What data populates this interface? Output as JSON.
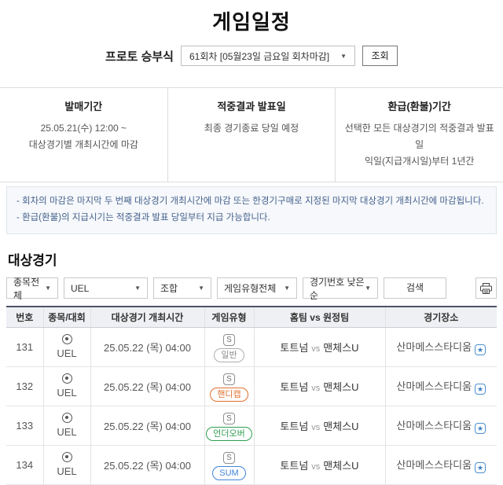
{
  "page": {
    "title": "게임일정"
  },
  "proto": {
    "label": "프로토 승부식",
    "round_selected": "61회차 [05월23일 금요일 회차마감]",
    "inquiry_button": "조회"
  },
  "info_columns": {
    "sale": {
      "title": "발매기간",
      "line1": "25.05.21(수) 12:00 ~",
      "line2": "대상경기별 개최시간에 마감"
    },
    "result": {
      "title": "적중결과 발표일",
      "line1": "최종 경기종료 당일 예정"
    },
    "refund": {
      "title": "환급(환불)기간",
      "line1": "선택한 모든 대상경기의 적중결과 발표일",
      "line2": "익일(지급개시일)부터 1년간"
    }
  },
  "notes": {
    "line1": "- 회차의 마감은 마지막 두 번째 대상경기 개최시간에 마감 또는 한경기구매로 지정된 마지막 대상경기 개최시간에 마감됩니다.",
    "line2": "- 환급(환불)의 지급시기는 적중결과 발표 당일부터 지급 가능합니다."
  },
  "target_section": {
    "title": "대상경기",
    "filters": {
      "sport": "종목전체",
      "league": "UEL",
      "combo": "조합",
      "game_type": "게임유형전체",
      "sort": "경기번호 낮은순"
    },
    "search_button": "검색",
    "print_icon": "printer-icon"
  },
  "colors": {
    "type_normal": "#aeaeae",
    "type_handicap": "#e0702f",
    "type_underover": "#2f9e50",
    "type_sum": "#4184d9",
    "venue_link": "#3a72b5",
    "header_top_border": "#4c5465",
    "note_text": "#44618c"
  },
  "table": {
    "headers": {
      "no": "번호",
      "league": "종목/대회",
      "time": "대상경기 개최시간",
      "type": "게임유형",
      "teams": "홈팀 vs 원정팀",
      "venue": "경기장소"
    },
    "s_badge": "S",
    "vs": "vs",
    "star": "★",
    "rows": [
      {
        "no": "131",
        "league": "UEL",
        "time": "25.05.22 (목) 04:00",
        "type_label": "일반",
        "home": "토트넘",
        "away": "맨체스U",
        "venue": "산마메스스타디움"
      },
      {
        "no": "132",
        "league": "UEL",
        "time": "25.05.22 (목) 04:00",
        "type_label": "핸디캡",
        "home": "토트넘",
        "away": "맨체스U",
        "venue": "산마메스스타디움"
      },
      {
        "no": "133",
        "league": "UEL",
        "time": "25.05.22 (목) 04:00",
        "type_label": "언더오버",
        "home": "토트넘",
        "away": "맨체스U",
        "venue": "산마메스스타디움"
      },
      {
        "no": "134",
        "league": "UEL",
        "time": "25.05.22 (목) 04:00",
        "type_label": "SUM",
        "home": "토트넘",
        "away": "맨체스U",
        "venue": "산마메스스타디움"
      }
    ]
  }
}
